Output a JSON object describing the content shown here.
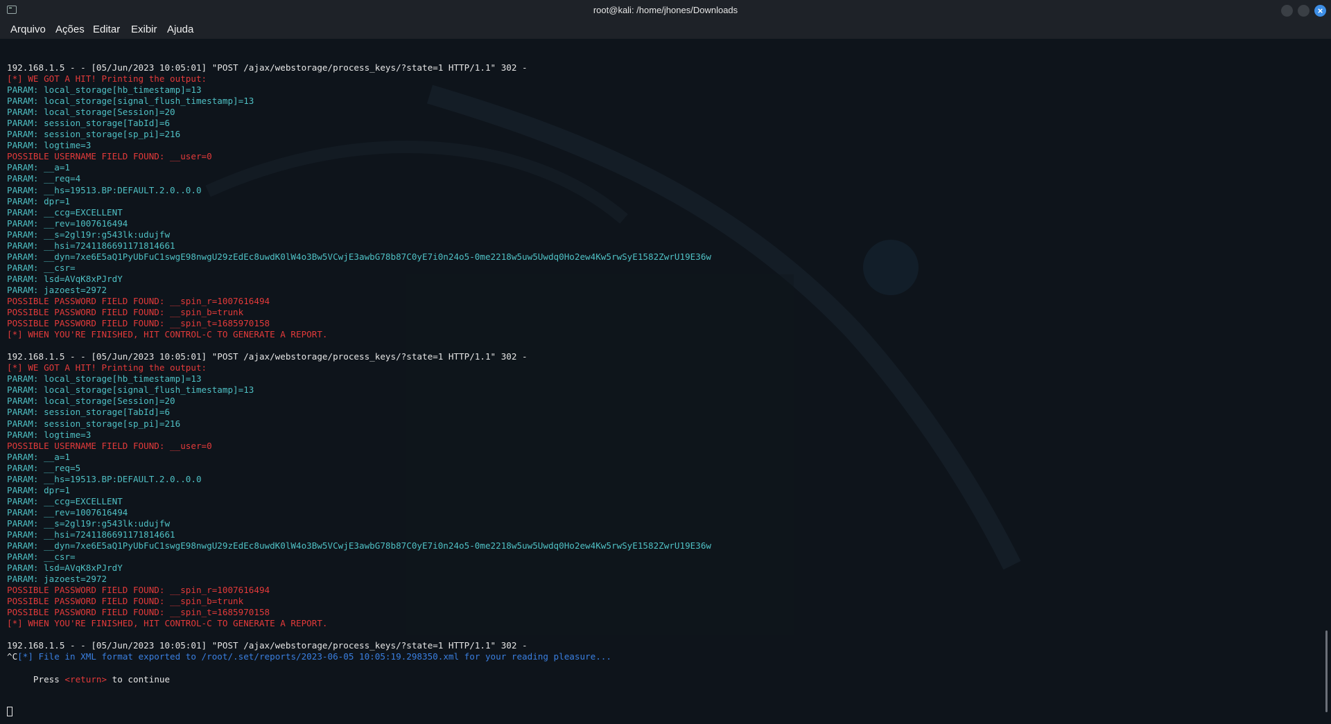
{
  "window": {
    "title": "root@kali: /home/jhones/Downloads"
  },
  "menu": {
    "items": [
      "Arquivo",
      "Ações",
      "Editar",
      "Exibir",
      "Ajuda"
    ]
  },
  "colors": {
    "background": "#0e141b",
    "text": "#e6e6e6",
    "red": "#e33a3a",
    "cyan": "#4fc0c4",
    "blue": "#3a7fe0",
    "close_button": "#3d8ee6"
  },
  "terminal": {
    "lines": [
      {
        "segments": [
          {
            "c": "white",
            "t": "192.168.1.5 - - [05/Jun/2023 10:05:01] \"POST /ajax/webstorage/process_keys/?state=1 HTTP/1.1\" 302 -"
          }
        ]
      },
      {
        "segments": [
          {
            "c": "red",
            "t": "[*] WE GOT A HIT! Printing the output:"
          }
        ]
      },
      {
        "segments": [
          {
            "c": "cyan",
            "t": "PARAM: local_storage[hb_timestamp]=13"
          }
        ]
      },
      {
        "segments": [
          {
            "c": "cyan",
            "t": "PARAM: local_storage[signal_flush_timestamp]=13"
          }
        ]
      },
      {
        "segments": [
          {
            "c": "cyan",
            "t": "PARAM: local_storage[Session]=20"
          }
        ]
      },
      {
        "segments": [
          {
            "c": "cyan",
            "t": "PARAM: session_storage[TabId]=6"
          }
        ]
      },
      {
        "segments": [
          {
            "c": "cyan",
            "t": "PARAM: session_storage[sp_pi]=216"
          }
        ]
      },
      {
        "segments": [
          {
            "c": "cyan",
            "t": "PARAM: logtime=3"
          }
        ]
      },
      {
        "segments": [
          {
            "c": "red",
            "t": "POSSIBLE USERNAME FIELD FOUND: __user=0"
          }
        ]
      },
      {
        "segments": [
          {
            "c": "cyan",
            "t": "PARAM: __a=1"
          }
        ]
      },
      {
        "segments": [
          {
            "c": "cyan",
            "t": "PARAM: __req=4"
          }
        ]
      },
      {
        "segments": [
          {
            "c": "cyan",
            "t": "PARAM: __hs=19513.BP:DEFAULT.2.0..0.0"
          }
        ]
      },
      {
        "segments": [
          {
            "c": "cyan",
            "t": "PARAM: dpr=1"
          }
        ]
      },
      {
        "segments": [
          {
            "c": "cyan",
            "t": "PARAM: __ccg=EXCELLENT"
          }
        ]
      },
      {
        "segments": [
          {
            "c": "cyan",
            "t": "PARAM: __rev=1007616494"
          }
        ]
      },
      {
        "segments": [
          {
            "c": "cyan",
            "t": "PARAM: __s=2gl19r:g543lk:udujfw"
          }
        ]
      },
      {
        "segments": [
          {
            "c": "cyan",
            "t": "PARAM: __hsi=7241186691171814661"
          }
        ]
      },
      {
        "segments": [
          {
            "c": "cyan",
            "t": "PARAM: __dyn=7xe6E5aQ1PyUbFuC1swgE98nwgU29zEdEc8uwdK0lW4o3Bw5VCwjE3awbG78b87C0yE7i0n24o5-0me2218w5uw5Uwdq0Ho2ew4Kw5rwSyE1582ZwrU19E36w"
          }
        ]
      },
      {
        "segments": [
          {
            "c": "cyan",
            "t": "PARAM: __csr="
          }
        ]
      },
      {
        "segments": [
          {
            "c": "cyan",
            "t": "PARAM: lsd=AVqK8xPJrdY"
          }
        ]
      },
      {
        "segments": [
          {
            "c": "cyan",
            "t": "PARAM: jazoest=2972"
          }
        ]
      },
      {
        "segments": [
          {
            "c": "red",
            "t": "POSSIBLE PASSWORD FIELD FOUND: __spin_r=1007616494"
          }
        ]
      },
      {
        "segments": [
          {
            "c": "red",
            "t": "POSSIBLE PASSWORD FIELD FOUND: __spin_b=trunk"
          }
        ]
      },
      {
        "segments": [
          {
            "c": "red",
            "t": "POSSIBLE PASSWORD FIELD FOUND: __spin_t=1685970158"
          }
        ]
      },
      {
        "segments": [
          {
            "c": "red",
            "t": "[*] WHEN YOU'RE FINISHED, HIT CONTROL-C TO GENERATE A REPORT."
          }
        ]
      },
      {
        "segments": [
          {
            "c": "white",
            "t": ""
          }
        ]
      },
      {
        "segments": [
          {
            "c": "white",
            "t": "192.168.1.5 - - [05/Jun/2023 10:05:01] \"POST /ajax/webstorage/process_keys/?state=1 HTTP/1.1\" 302 -"
          }
        ]
      },
      {
        "segments": [
          {
            "c": "red",
            "t": "[*] WE GOT A HIT! Printing the output:"
          }
        ]
      },
      {
        "segments": [
          {
            "c": "cyan",
            "t": "PARAM: local_storage[hb_timestamp]=13"
          }
        ]
      },
      {
        "segments": [
          {
            "c": "cyan",
            "t": "PARAM: local_storage[signal_flush_timestamp]=13"
          }
        ]
      },
      {
        "segments": [
          {
            "c": "cyan",
            "t": "PARAM: local_storage[Session]=20"
          }
        ]
      },
      {
        "segments": [
          {
            "c": "cyan",
            "t": "PARAM: session_storage[TabId]=6"
          }
        ]
      },
      {
        "segments": [
          {
            "c": "cyan",
            "t": "PARAM: session_storage[sp_pi]=216"
          }
        ]
      },
      {
        "segments": [
          {
            "c": "cyan",
            "t": "PARAM: logtime=3"
          }
        ]
      },
      {
        "segments": [
          {
            "c": "red",
            "t": "POSSIBLE USERNAME FIELD FOUND: __user=0"
          }
        ]
      },
      {
        "segments": [
          {
            "c": "cyan",
            "t": "PARAM: __a=1"
          }
        ]
      },
      {
        "segments": [
          {
            "c": "cyan",
            "t": "PARAM: __req=5"
          }
        ]
      },
      {
        "segments": [
          {
            "c": "cyan",
            "t": "PARAM: __hs=19513.BP:DEFAULT.2.0..0.0"
          }
        ]
      },
      {
        "segments": [
          {
            "c": "cyan",
            "t": "PARAM: dpr=1"
          }
        ]
      },
      {
        "segments": [
          {
            "c": "cyan",
            "t": "PARAM: __ccg=EXCELLENT"
          }
        ]
      },
      {
        "segments": [
          {
            "c": "cyan",
            "t": "PARAM: __rev=1007616494"
          }
        ]
      },
      {
        "segments": [
          {
            "c": "cyan",
            "t": "PARAM: __s=2gl19r:g543lk:udujfw"
          }
        ]
      },
      {
        "segments": [
          {
            "c": "cyan",
            "t": "PARAM: __hsi=7241186691171814661"
          }
        ]
      },
      {
        "segments": [
          {
            "c": "cyan",
            "t": "PARAM: __dyn=7xe6E5aQ1PyUbFuC1swgE98nwgU29zEdEc8uwdK0lW4o3Bw5VCwjE3awbG78b87C0yE7i0n24o5-0me2218w5uw5Uwdq0Ho2ew4Kw5rwSyE1582ZwrU19E36w"
          }
        ]
      },
      {
        "segments": [
          {
            "c": "cyan",
            "t": "PARAM: __csr="
          }
        ]
      },
      {
        "segments": [
          {
            "c": "cyan",
            "t": "PARAM: lsd=AVqK8xPJrdY"
          }
        ]
      },
      {
        "segments": [
          {
            "c": "cyan",
            "t": "PARAM: jazoest=2972"
          }
        ]
      },
      {
        "segments": [
          {
            "c": "red",
            "t": "POSSIBLE PASSWORD FIELD FOUND: __spin_r=1007616494"
          }
        ]
      },
      {
        "segments": [
          {
            "c": "red",
            "t": "POSSIBLE PASSWORD FIELD FOUND: __spin_b=trunk"
          }
        ]
      },
      {
        "segments": [
          {
            "c": "red",
            "t": "POSSIBLE PASSWORD FIELD FOUND: __spin_t=1685970158"
          }
        ]
      },
      {
        "segments": [
          {
            "c": "red",
            "t": "[*] WHEN YOU'RE FINISHED, HIT CONTROL-C TO GENERATE A REPORT."
          }
        ]
      },
      {
        "segments": [
          {
            "c": "white",
            "t": ""
          }
        ]
      },
      {
        "segments": [
          {
            "c": "white",
            "t": "192.168.1.5 - - [05/Jun/2023 10:05:01] \"POST /ajax/webstorage/process_keys/?state=1 HTTP/1.1\" 302 -"
          }
        ]
      },
      {
        "segments": [
          {
            "c": "white",
            "t": "^C"
          },
          {
            "c": "blue",
            "t": "[*] File in XML format exported to /root/.set/reports/2023-06-05 10:05:19.298350.xml for your reading pleasure..."
          }
        ]
      },
      {
        "segments": [
          {
            "c": "white",
            "t": ""
          }
        ]
      },
      {
        "segments": [
          {
            "c": "white",
            "t": "     Press "
          },
          {
            "c": "red",
            "t": "<return>"
          },
          {
            "c": "white",
            "t": " to continue"
          }
        ]
      }
    ]
  }
}
